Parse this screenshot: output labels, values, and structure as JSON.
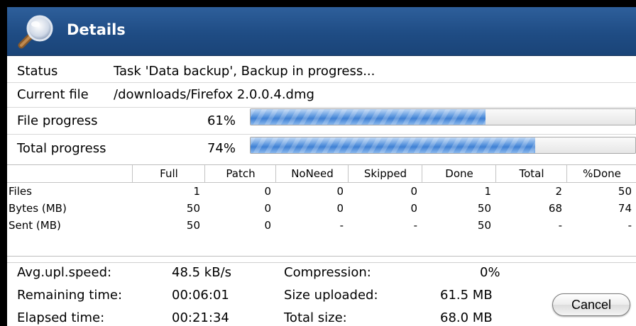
{
  "window": {
    "title": "Details",
    "title_icon": "magnifier-icon"
  },
  "status": {
    "label": "Status",
    "value": "Task 'Data backup', Backup in progress..."
  },
  "current_file": {
    "label": "Current file",
    "value": "/downloads/Firefox 2.0.0.4.dmg"
  },
  "file_progress": {
    "label": "File progress",
    "percent_text": "61%",
    "fraction": 0.61
  },
  "total_progress": {
    "label": "Total progress",
    "percent_text": "74%",
    "fraction": 0.74
  },
  "table": {
    "columns": [
      "Full",
      "Patch",
      "NoNeed",
      "Skipped",
      "Done",
      "Total",
      "%Done"
    ],
    "rows": [
      {
        "label": "Files",
        "values": [
          "1",
          "0",
          "0",
          "0",
          "1",
          "2",
          "50"
        ]
      },
      {
        "label": "Bytes (MB)",
        "values": [
          "50",
          "0",
          "0",
          "0",
          "50",
          "68",
          "74"
        ]
      },
      {
        "label": "Sent (MB)",
        "values": [
          "50",
          "0",
          "-",
          "-",
          "50",
          "-",
          "-"
        ]
      }
    ]
  },
  "stats": {
    "avg_speed": {
      "label": "Avg.upl.speed:",
      "value": "48.5 kB/s"
    },
    "remaining": {
      "label": "Remaining time:",
      "value": "00:06:01"
    },
    "elapsed": {
      "label": "Elapsed time:",
      "value": "00:21:34"
    },
    "compression": {
      "label": "Compression:",
      "value": "0%"
    },
    "size_uploaded": {
      "label": "Size uploaded:",
      "value": "61.5 MB"
    },
    "total_size": {
      "label": "Total size:",
      "value": "68.0 MB"
    }
  },
  "buttons": {
    "cancel": "Cancel"
  },
  "colors": {
    "titlebar": "#1f4c84",
    "progress": "#4a86d6"
  }
}
